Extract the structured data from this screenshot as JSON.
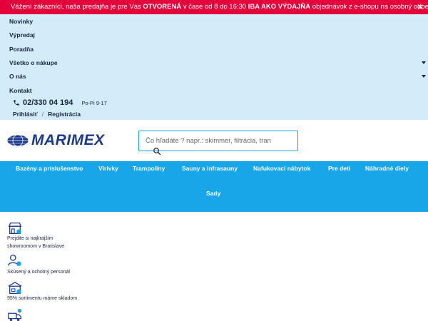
{
  "banner": {
    "text_1": "Vážení zákazníci, naša predajňa je pre Vás ",
    "bold_1": "OTVORENÁ",
    "text_2": " v čase od 8 do 16:30 ",
    "bold_2": "IBA AKO VÝDAJŇA",
    "text_3": " objednávok z e-shopu na osobný odber.",
    "close": "✕"
  },
  "nav": {
    "items": [
      {
        "label": "Novinky"
      },
      {
        "label": "Výpredaj"
      },
      {
        "label": "Poradňa"
      },
      {
        "label": "Všetko o nákupe"
      },
      {
        "label": "O nás"
      },
      {
        "label": "Kontakt"
      }
    ],
    "phone": "02/330 04 194",
    "hours": "Po-Pi 9-17",
    "login": "Prihlásiť",
    "separator": "/",
    "register": "Registrácia"
  },
  "header": {
    "logo_text": "MARIMEX",
    "search_placeholder": "Čo hľadáte ? napr.: skimmer, filtrácia, tran"
  },
  "categories": [
    {
      "label": "Bazény a príslušenstvo"
    },
    {
      "label": "Vírivky"
    },
    {
      "label": "Trampolíny"
    },
    {
      "label": "Sauny a infrasauny"
    },
    {
      "label": "Nafukovací nábytok"
    },
    {
      "label": "Pre deti"
    },
    {
      "label": "Náhradné diely"
    },
    {
      "label": "Sady"
    }
  ],
  "benefits": [
    {
      "line1": "Prejdite si najkrajším",
      "line2": "showroomom v Bratislave",
      "icon": "storefront-icon"
    },
    {
      "line1": "Skúsený a ochotný personál",
      "line2": "",
      "icon": "staff-icon"
    },
    {
      "line1": "95% sortimentu máme skladom",
      "line2": "",
      "icon": "warehouse-icon"
    },
    {
      "line1": "",
      "line2": "",
      "icon": "delivery-truck-icon"
    }
  ],
  "colors": {
    "banner": "#e4003a",
    "nav_panel": "#d2ecf9",
    "accent": "#18a6e8",
    "brand": "#1b3a8c"
  }
}
